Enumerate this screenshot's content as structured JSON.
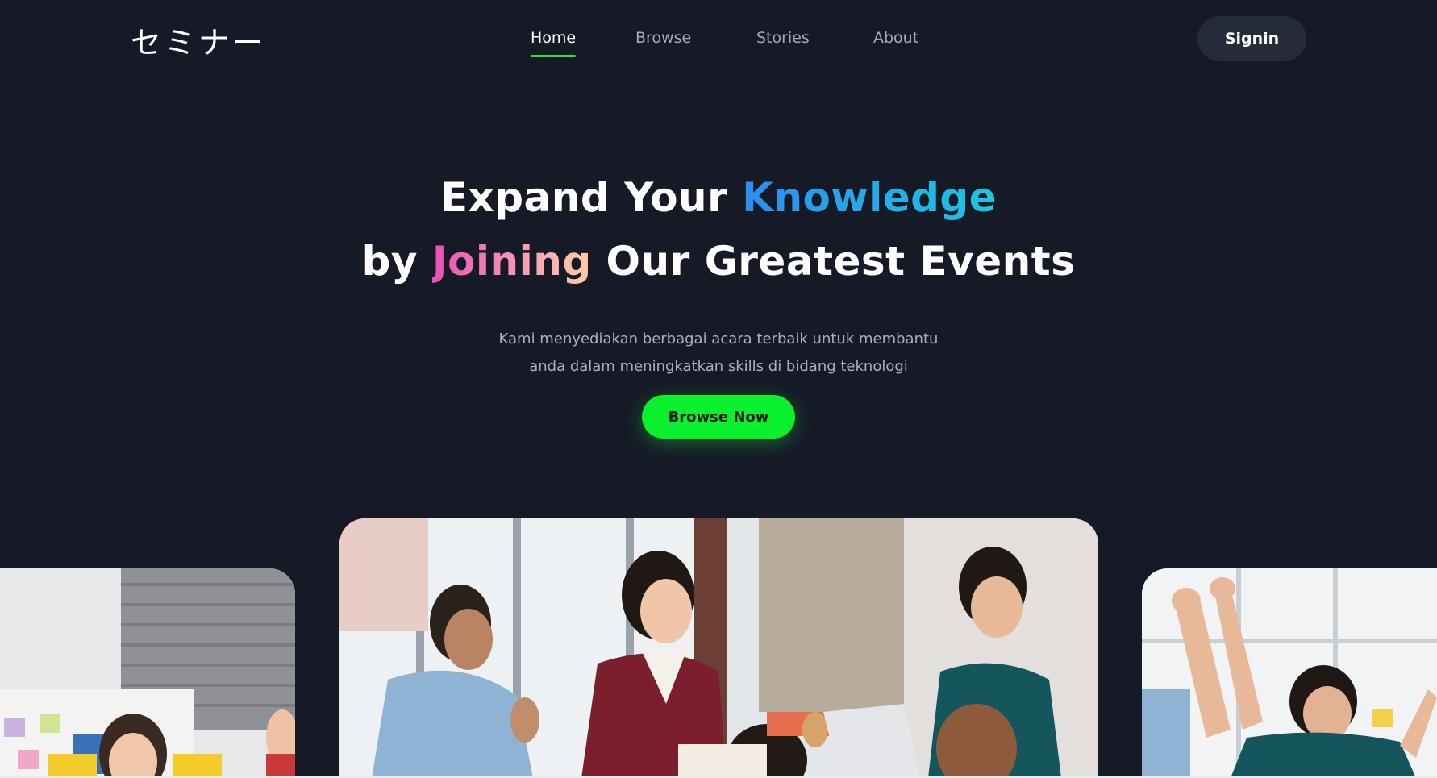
{
  "brand": {
    "logo_text": "セミナー"
  },
  "nav": {
    "items": [
      {
        "label": "Home",
        "active": true
      },
      {
        "label": "Browse",
        "active": false
      },
      {
        "label": "Stories",
        "active": false
      },
      {
        "label": "About",
        "active": false
      }
    ],
    "signin_label": "Signin"
  },
  "hero": {
    "line1_plain": "Expand Your ",
    "line1_highlight": "Knowledge",
    "line2_prefix": "by ",
    "line2_highlight": "Joining",
    "line2_suffix": " Our Greatest Events",
    "subtitle_line1": "Kami menyediakan berbagai acara terbaik untuk membantu",
    "subtitle_line2": "anda dalam meningkatkan skills di bidang teknologi",
    "cta_label": "Browse Now"
  },
  "colors": {
    "background": "#161a27",
    "accent_green": "#0bf02c",
    "highlight_blue_start": "#2d8cf0",
    "highlight_blue_end": "#19c8e0",
    "highlight_pink_start": "#ea4fb4",
    "highlight_pink_end": "#ffcfa4"
  }
}
